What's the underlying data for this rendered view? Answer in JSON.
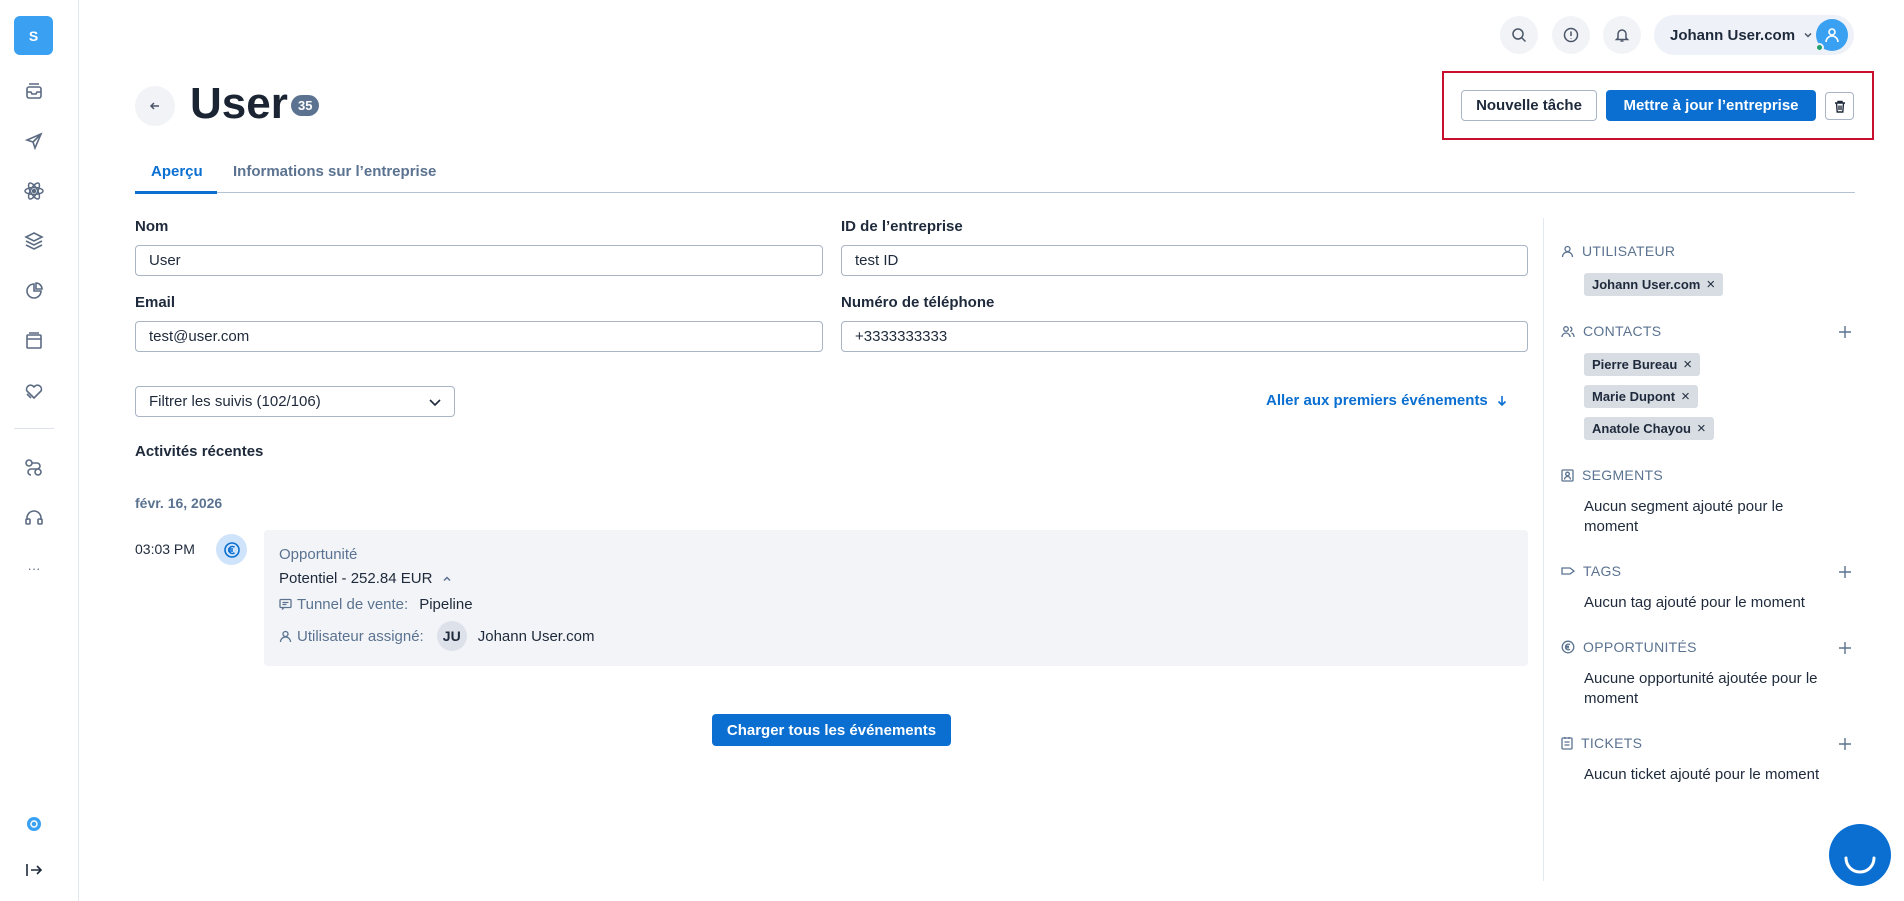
{
  "sidebar": {
    "logo_letter": "S",
    "items": [
      {
        "name": "inbox-icon"
      },
      {
        "name": "send-icon"
      },
      {
        "name": "atom-icon"
      },
      {
        "name": "layers-icon"
      },
      {
        "name": "pie-chart-icon"
      },
      {
        "name": "window-icon"
      },
      {
        "name": "heart-tag-icon"
      },
      {
        "name": "workflow-icon"
      },
      {
        "name": "headset-icon"
      }
    ],
    "more_label": "···"
  },
  "topbar": {
    "user_name": "Johann User.com"
  },
  "header": {
    "title": "User",
    "count": "35",
    "new_task_label": "Nouvelle tâche",
    "update_label": "Mettre à jour l’entreprise"
  },
  "tabs": [
    {
      "label": "Aperçu",
      "active": true
    },
    {
      "label": "Informations sur l’entreprise",
      "active": false
    }
  ],
  "form": {
    "name_label": "Nom",
    "name_value": "User",
    "company_id_label": "ID de l’entreprise",
    "company_id_value": "test ID",
    "email_label": "Email",
    "email_value": "test@user.com",
    "phone_label": "Numéro de téléphone",
    "phone_value": "+3333333333"
  },
  "activity": {
    "filter_label": "Filtrer les suivis (102/106)",
    "goto_label": "Aller aux premiers événements",
    "heading": "Activités récentes",
    "date": "févr. 16, 2026",
    "event": {
      "time": "03:03 PM",
      "type": "Opportunité",
      "title": "Potentiel - 252.84 EUR",
      "pipeline_label": "Tunnel de vente:",
      "pipeline_value": "Pipeline",
      "assignee_label": "Utilisateur assigné:",
      "assignee_initials": "JU",
      "assignee_name": "Johann User.com"
    },
    "load_all_label": "Charger tous les événements"
  },
  "right_panel": {
    "user_heading": "UTILISATEUR",
    "user_chip": "Johann User.com",
    "contacts_heading": "CONTACTS",
    "contacts": [
      "Pierre Bureau",
      "Marie Dupont",
      "Anatole Chayou"
    ],
    "segments_heading": "SEGMENTS",
    "segments_empty": "Aucun segment ajouté pour le moment",
    "tags_heading": "TAGS",
    "tags_empty": "Aucun tag ajouté pour le moment",
    "opportunities_heading": "OPPORTUNITÉS",
    "opportunities_empty": "Aucune opportunité ajoutée pour le moment",
    "tickets_heading": "TICKETS",
    "tickets_empty": "Aucun ticket ajouté pour le moment"
  },
  "colors": {
    "primary": "#0a6fd1",
    "highlight_border": "#c8102e",
    "logo": "#3aa0f2"
  }
}
